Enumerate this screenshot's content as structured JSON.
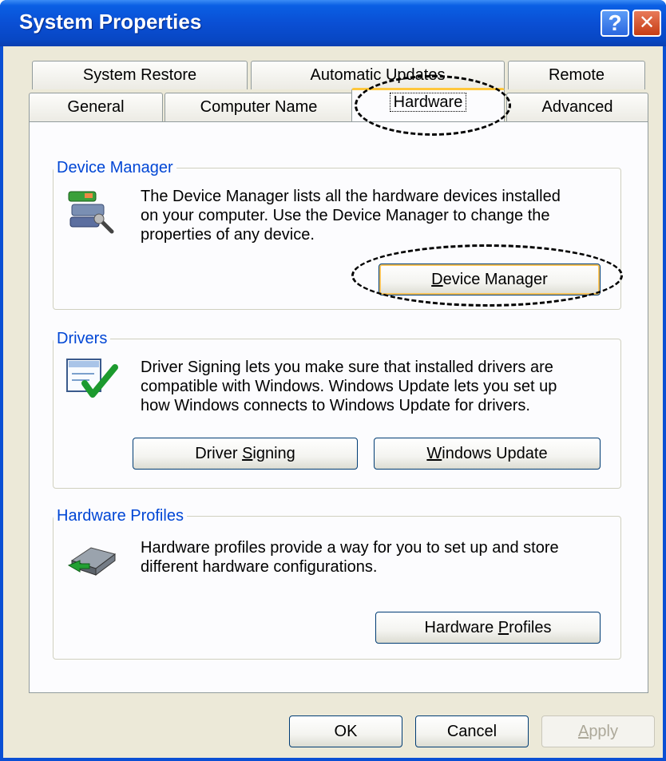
{
  "window": {
    "title": "System Properties"
  },
  "titlebar": {
    "help_glyph": "?",
    "close_glyph": "✕"
  },
  "tabs": {
    "row1": [
      "System Restore",
      "Automatic Updates",
      "Remote"
    ],
    "row2": [
      "General",
      "Computer Name",
      "Hardware",
      "Advanced"
    ],
    "selected": "Hardware"
  },
  "device_manager": {
    "label": "Device Manager",
    "line1": "The Device Manager lists all the hardware devices installed",
    "line2": "on your computer. Use the Device Manager to change the",
    "line3": "properties of any device.",
    "button_pre": "",
    "button_mnemonic": "D",
    "button_post": "evice Manager",
    "icon": "device-manager-icon"
  },
  "drivers": {
    "label": "Drivers",
    "line1": "Driver Signing lets you make sure that installed drivers are",
    "line2": "compatible with Windows. Windows Update lets you set up",
    "line3": "how Windows connects to Windows Update for drivers.",
    "signing_pre": "Driver ",
    "signing_mnemonic": "S",
    "signing_post": "igning",
    "update_pre": "",
    "update_mnemonic": "W",
    "update_post": "indows Update",
    "icon": "driver-signing-icon"
  },
  "hardware_profiles": {
    "label": "Hardware Profiles",
    "line1": "Hardware profiles provide a way for you to set up and store",
    "line2": "different hardware configurations.",
    "button_pre": "Hardware ",
    "button_mnemonic": "P",
    "button_post": "rofiles",
    "icon": "hardware-profiles-icon"
  },
  "footer": {
    "ok": "OK",
    "cancel": "Cancel",
    "apply_mnemonic": "A",
    "apply_post": "pply"
  },
  "colors": {
    "titlebar": "#0a4fd4",
    "group_label": "#0046d5",
    "tab_highlight": "#ffc73c"
  }
}
